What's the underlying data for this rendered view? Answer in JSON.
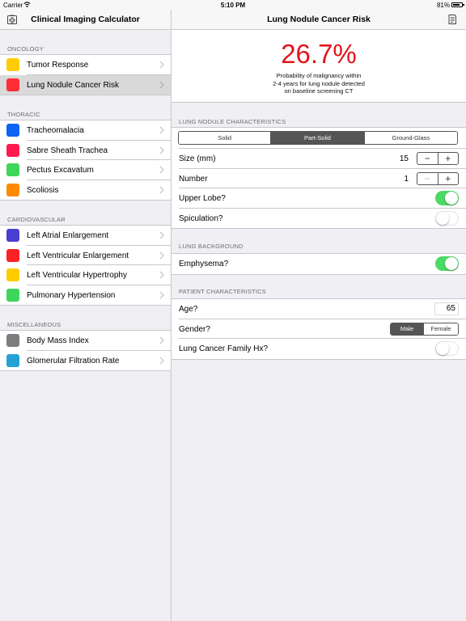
{
  "status": {
    "carrier": "Carrier",
    "time": "5:10 PM",
    "battery": "81%",
    "battery_level": 0.81
  },
  "sidebar": {
    "title": "Clinical Imaging Calculator",
    "sections": [
      {
        "header": "ONCOLOGY",
        "items": [
          {
            "label": "Tumor Response",
            "color": "#ffcc00"
          },
          {
            "label": "Lung Nodule Cancer Risk",
            "color": "#ff2d36"
          }
        ]
      },
      {
        "header": "THORACIC",
        "items": [
          {
            "label": "Tracheomalacia",
            "color": "#0b64f5"
          },
          {
            "label": "Sabre Sheath Trachea",
            "color": "#ff1b50"
          },
          {
            "label": "Pectus Excavatum",
            "color": "#3dd65a"
          },
          {
            "label": "Scoliosis",
            "color": "#ff8a00"
          }
        ]
      },
      {
        "header": "CARDIOVASCULAR",
        "items": [
          {
            "label": "Left Atrial Enlargement",
            "color": "#4a3fd1"
          },
          {
            "label": "Left Ventricular Enlargement",
            "color": "#ff2125"
          },
          {
            "label": "Left Ventricular Hypertrophy",
            "color": "#ffcc00"
          },
          {
            "label": "Pulmonary Hypertension",
            "color": "#3dd65a"
          }
        ]
      },
      {
        "header": "MISCELLANEOUS",
        "items": [
          {
            "label": "Body Mass Index",
            "color": "#7d7d80"
          },
          {
            "label": "Glomerular Filtration Rate",
            "color": "#26a1d6"
          }
        ]
      }
    ]
  },
  "main": {
    "title": "Lung Nodule Cancer Risk",
    "result": {
      "value": "26.7%",
      "line1": "Probability of malignancy within",
      "line2": "2-4 years for lung nodule detected",
      "line3": "on baseline screening CT",
      "color": "#e3141c"
    },
    "nodule": {
      "header": "LUNG NODULE CHARACTERISTICS",
      "types": [
        "Solid",
        "Part-Solid",
        "Ground-Glass"
      ],
      "selected_type": "Part-Solid",
      "size_label": "Size (mm)",
      "size_value": "15",
      "number_label": "Number",
      "number_value": "1",
      "stepper_minus": "−",
      "stepper_plus": "+",
      "upper_lobe_label": "Upper Lobe?",
      "upper_lobe": true,
      "spiculation_label": "Spiculation?",
      "spiculation": false
    },
    "background": {
      "header": "LUNG BACKGROUND",
      "emphysema_label": "Emphysema?",
      "emphysema": true
    },
    "patient": {
      "header": "PATIENT CHARACTERISTICS",
      "age_label": "Age?",
      "age_value": "65",
      "gender_label": "Gender?",
      "genders": [
        "Male",
        "Female"
      ],
      "selected_gender": "Male",
      "family_label": "Lung Cancer Family Hx?",
      "family": false
    }
  },
  "icons": {
    "left_nav": "medical-cross-icon",
    "right_nav": "notes-icon",
    "toggle_on_color": "#4cd964"
  }
}
